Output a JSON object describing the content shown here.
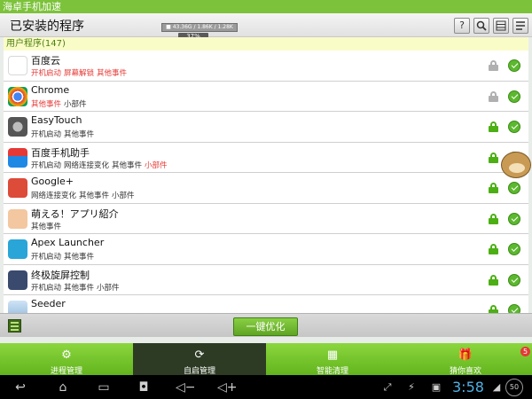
{
  "app_title": "海卓手机加速",
  "header": {
    "title": "已安装的程序",
    "memory_readout": "■ 43.36G / 1.86K / 1.28K",
    "memory_percent": "37%",
    "help_label": "?",
    "search_icon": "search-icon",
    "list_icon": "list-view-icon",
    "menu_icon": "menu-icon"
  },
  "section_title": "用户程序(147)",
  "apps": [
    {
      "name": "百度云",
      "tags": [
        {
          "text": "开机启动",
          "color": "red"
        },
        {
          "text": "屏幕解锁",
          "color": "red"
        },
        {
          "text": "其他事件",
          "color": "red"
        }
      ],
      "locked": false
    },
    {
      "name": "Chrome",
      "tags": [
        {
          "text": "其他事件",
          "color": "red"
        },
        {
          "text": "小部件",
          "color": "normal"
        }
      ],
      "locked": false
    },
    {
      "name": "EasyTouch",
      "tags": [
        {
          "text": "开机启动",
          "color": "normal"
        },
        {
          "text": "其他事件",
          "color": "normal"
        }
      ],
      "locked": true
    },
    {
      "name": "百度手机助手",
      "tags": [
        {
          "text": "开机启动",
          "color": "normal"
        },
        {
          "text": "网络连接变化",
          "color": "normal"
        },
        {
          "text": "其他事件",
          "color": "normal"
        },
        {
          "text": "小部件",
          "color": "red"
        }
      ],
      "locked": true
    },
    {
      "name": "Google+",
      "tags": [
        {
          "text": "网络连接变化",
          "color": "normal"
        },
        {
          "text": "其他事件",
          "color": "normal"
        },
        {
          "text": "小部件",
          "color": "normal"
        }
      ],
      "locked": true
    },
    {
      "name": "萌える！アプリ紹介",
      "tags": [
        {
          "text": "其他事件",
          "color": "normal"
        }
      ],
      "locked": true
    },
    {
      "name": "Apex Launcher",
      "tags": [
        {
          "text": "开机启动",
          "color": "normal"
        },
        {
          "text": "其他事件",
          "color": "normal"
        }
      ],
      "locked": true
    },
    {
      "name": "终极旋屏控制",
      "tags": [
        {
          "text": "开机启动",
          "color": "normal"
        },
        {
          "text": "其他事件",
          "color": "normal"
        },
        {
          "text": "小部件",
          "color": "normal"
        }
      ],
      "locked": true
    },
    {
      "name": "Seeder",
      "tags": [],
      "locked": true
    }
  ],
  "bottom": {
    "optimize_label": "一键优化"
  },
  "tabs": [
    {
      "label": "进程管理",
      "icon": "process-icon",
      "active": false
    },
    {
      "label": "自启管理",
      "icon": "autostart-icon",
      "active": true
    },
    {
      "label": "智能清理",
      "icon": "clean-icon",
      "active": false
    },
    {
      "label": "猜你喜欢",
      "icon": "gift-icon",
      "active": false
    }
  ],
  "badge_count": "5",
  "status": {
    "time": "3:58",
    "battery": "50"
  },
  "colors": {
    "accent_green": "#7cc23a",
    "red_tag": "#e53935",
    "active_tab": "#2d3b24"
  }
}
